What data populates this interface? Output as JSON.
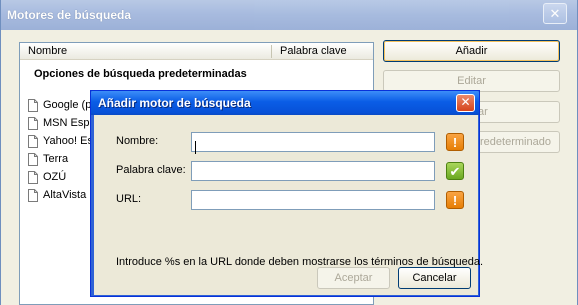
{
  "background_window": {
    "title": "Motores de búsqueda",
    "close_glyph": "✕",
    "list": {
      "col_name": "Nombre",
      "col_keyword": "Palabra clave",
      "group_title": "Opciones de búsqueda predeterminadas",
      "items": [
        {
          "label": "Google (pre",
          "icon": "document-icon"
        },
        {
          "label": "MSN Españ",
          "icon": "document-icon"
        },
        {
          "label": "Yahoo! Esp",
          "icon": "document-icon"
        },
        {
          "label": "Terra",
          "icon": "document-icon"
        },
        {
          "label": "OZÚ",
          "icon": "document-icon"
        },
        {
          "label": "AltaVista",
          "icon": "document-icon"
        }
      ]
    },
    "buttons": {
      "add": "Añadir",
      "edit": "Editar",
      "delete": "ar",
      "set_default": "redeterminado"
    }
  },
  "dialog": {
    "title": "Añadir motor de búsqueda",
    "close_glyph": "✕",
    "fields": {
      "name_label": "Nombre:",
      "name_value": "",
      "keyword_label": "Palabra clave:",
      "keyword_value": "",
      "url_label": "URL:",
      "url_value": ""
    },
    "status": {
      "name": {
        "icon": "warning-icon",
        "glyph": "!",
        "color": "#e67e05"
      },
      "keyword": {
        "icon": "checkmark-icon",
        "glyph": "✔",
        "color": "#6aa821"
      },
      "url": {
        "icon": "warning-icon",
        "glyph": "!",
        "color": "#e67e05"
      }
    },
    "hint": "Introduce %s en la URL donde deben mostrarse los términos de búsqueda.",
    "buttons": {
      "accept": "Aceptar",
      "cancel": "Cancelar"
    }
  }
}
